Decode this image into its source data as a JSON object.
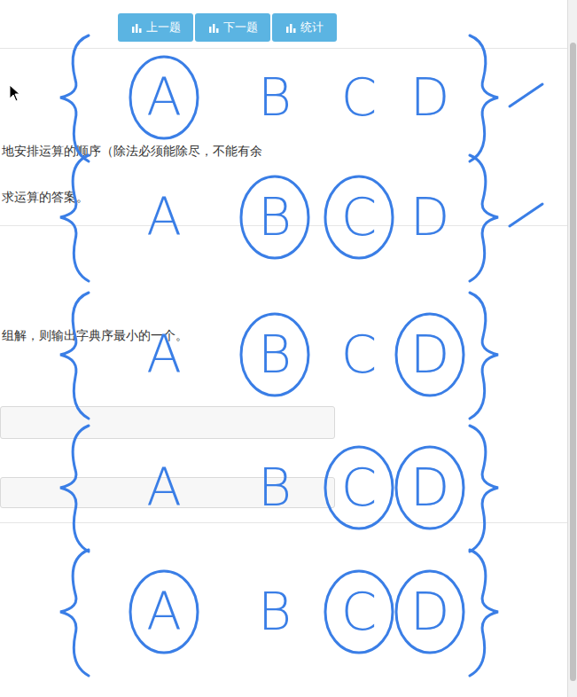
{
  "toolbar": {
    "buttons": [
      {
        "label": "上一题"
      },
      {
        "label": "下一题"
      },
      {
        "label": "统计"
      }
    ]
  },
  "problem": {
    "lines": [
      "地安排运算的顺序（除法必须能除尽，不能有余",
      "求运算的答案。",
      "组解，则输出字典序最小的一个。"
    ]
  },
  "annotation": {
    "rows": [
      {
        "letters": [
          {
            "text": "A",
            "circled": true
          },
          {
            "text": "B",
            "circled": false
          },
          {
            "text": "C",
            "circled": false
          },
          {
            "text": "D",
            "circled": false
          }
        ],
        "checked": true
      },
      {
        "letters": [
          {
            "text": "A",
            "circled": false
          },
          {
            "text": "B",
            "circled": true
          },
          {
            "text": "C",
            "circled": true
          },
          {
            "text": "D",
            "circled": false
          }
        ],
        "checked": true
      },
      {
        "letters": [
          {
            "text": "A",
            "circled": false
          },
          {
            "text": "B",
            "circled": true
          },
          {
            "text": "C",
            "circled": false
          },
          {
            "text": "D",
            "circled": true
          }
        ],
        "checked": false
      },
      {
        "letters": [
          {
            "text": "A",
            "circled": false
          },
          {
            "text": "B",
            "circled": false
          },
          {
            "text": "C",
            "circled": true
          },
          {
            "text": "D",
            "circled": true
          }
        ],
        "checked": false
      },
      {
        "letters": [
          {
            "text": "A",
            "circled": true
          },
          {
            "text": "B",
            "circled": false
          },
          {
            "text": "C",
            "circled": true
          },
          {
            "text": "D",
            "circled": true
          }
        ],
        "checked": false
      }
    ]
  }
}
